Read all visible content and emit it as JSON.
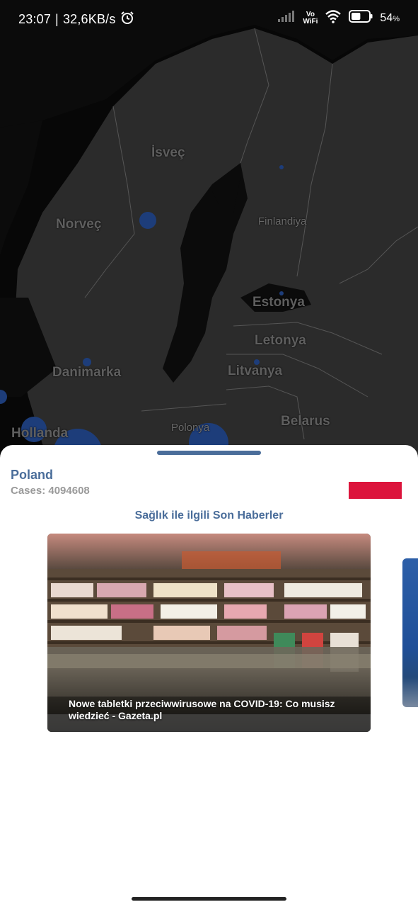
{
  "status_bar": {
    "time": "23:07",
    "separator": "|",
    "network_speed": "32,6KB/s",
    "alarm_icon": "alarm-clock-icon",
    "signal_icon": "cellular-signal-icon",
    "volte_top": "Vo",
    "volte_bottom": "WiFi",
    "wifi_icon": "wifi-icon",
    "battery_icon": "battery-icon",
    "battery_level": 0.54,
    "battery_percent": "54",
    "battery_percent_sign": "%"
  },
  "map": {
    "labels": {
      "sweden": "İsveç",
      "norway": "Norveç",
      "finland": "Finlandiya",
      "estonia": "Estonya",
      "latvia": "Letonya",
      "lithuania": "Litvanya",
      "denmark": "Danimarka",
      "netherlands": "Hollanda",
      "poland": "Polonya",
      "belarus": "Belarus"
    },
    "marker_color": "#1d3d7a",
    "background_color": "#070707",
    "land_color": "#2b2b2b"
  },
  "sheet": {
    "country": "Poland",
    "cases_label": "Cases:",
    "cases_value": "4094608",
    "flag_colors": [
      "#ffffff",
      "#dc143c"
    ],
    "news_heading": "Sağlık ile ilgili Son Haberler",
    "news": [
      {
        "title_line1": "Nowe tabletki przeciwwirusowe na COVID-19: Co musisz",
        "title_line2": "wiedzieć - Gazeta.pl"
      }
    ],
    "accent_color": "#4a6d9a"
  }
}
